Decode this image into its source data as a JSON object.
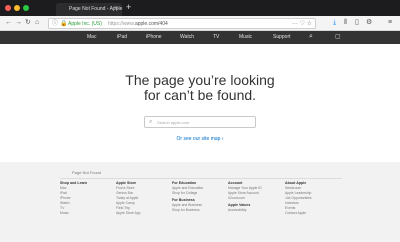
{
  "browser": {
    "tab_title": "Page Not Found - Apple",
    "tab_close": "×",
    "new_tab": "+",
    "url_company": "Apple Inc. (US)",
    "url_scheme": "https://www.",
    "url_host_path": "apple.com/404",
    "url_actions": "··· ♡ ☆",
    "icons": [
      "back-icon",
      "forward-icon",
      "reload-icon",
      "home-icon",
      "info-icon",
      "lock-icon",
      "download-icon",
      "library-icon",
      "sidebar-icon",
      "settings-icon",
      "menu-icon"
    ]
  },
  "globalnav": {
    "apple_logo": "",
    "items": [
      "Mac",
      "iPad",
      "iPhone",
      "Watch",
      "TV",
      "Music",
      "Support"
    ],
    "search_icon": "⌕",
    "bag_icon": "▢"
  },
  "main": {
    "headline_line1": "The page you’re looking",
    "headline_line2": "for can’t be found.",
    "search_placeholder": "Search apple.com",
    "sitemap_link": "Or see our site map ›"
  },
  "footer": {
    "breadcrumb": "Page Not Found",
    "columns": [
      {
        "heading": "Shop and Learn",
        "items": [
          "Mac",
          "iPad",
          "iPhone",
          "Watch",
          "TV",
          "Music"
        ]
      },
      {
        "heading": "Apple Store",
        "items": [
          "Find a Store",
          "Genius Bar",
          "Today at Apple",
          "Apple Camp",
          "Field Trip",
          "Apple Store App"
        ]
      },
      {
        "heading": "For Education",
        "items": [
          "Apple and Education",
          "Shop for College"
        ],
        "heading2": "For Business",
        "items2": [
          "Apple and Business",
          "Shop for Business"
        ]
      },
      {
        "heading": "Account",
        "items": [
          "Manage Your Apple ID",
          "Apple Store Account",
          "iCloud.com"
        ],
        "heading2": "Apple Values",
        "items2": [
          "Accessibility"
        ]
      },
      {
        "heading": "About Apple",
        "items": [
          "Newsroom",
          "Apple Leadership",
          "Job Opportunities",
          "Investors",
          "Events",
          "Contact Apple"
        ]
      }
    ]
  }
}
